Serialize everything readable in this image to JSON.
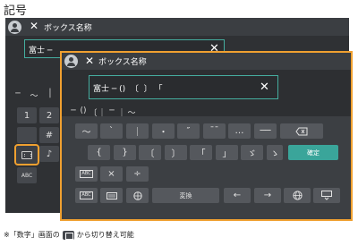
{
  "heading": "記号",
  "back_screen": {
    "title": "ボックス名称",
    "field_value": "富士 ─",
    "strip": [
      "─",
      "～",
      "│"
    ],
    "keys": [
      "1",
      "2",
      "#",
      "♪"
    ]
  },
  "front_screen": {
    "title": "ボックス名称",
    "field_value": "富士 ─ ()  〔  〕 「 ",
    "strip": [
      "─",
      "()",
      "〔",
      "｜",
      "─",
      "｜",
      "～"
    ],
    "row1": [
      "～",
      "ˋ",
      "｜",
      "・",
      "″",
      "¯¯",
      "…",
      "──"
    ],
    "row2": [
      "{",
      "}",
      "〔",
      "〕",
      "「",
      "」",
      "ゞ",
      "ゝ",
      "ヾ"
    ],
    "confirm_label": "確定",
    "row3": [
      "×",
      "÷"
    ],
    "row4_convert": "変換",
    "row4_arrows": [
      "←",
      "→"
    ],
    "layout_key_label": "ABC"
  },
  "note": {
    "prefix": "※「数字」画面の",
    "suffix": "から切り替え可能"
  }
}
